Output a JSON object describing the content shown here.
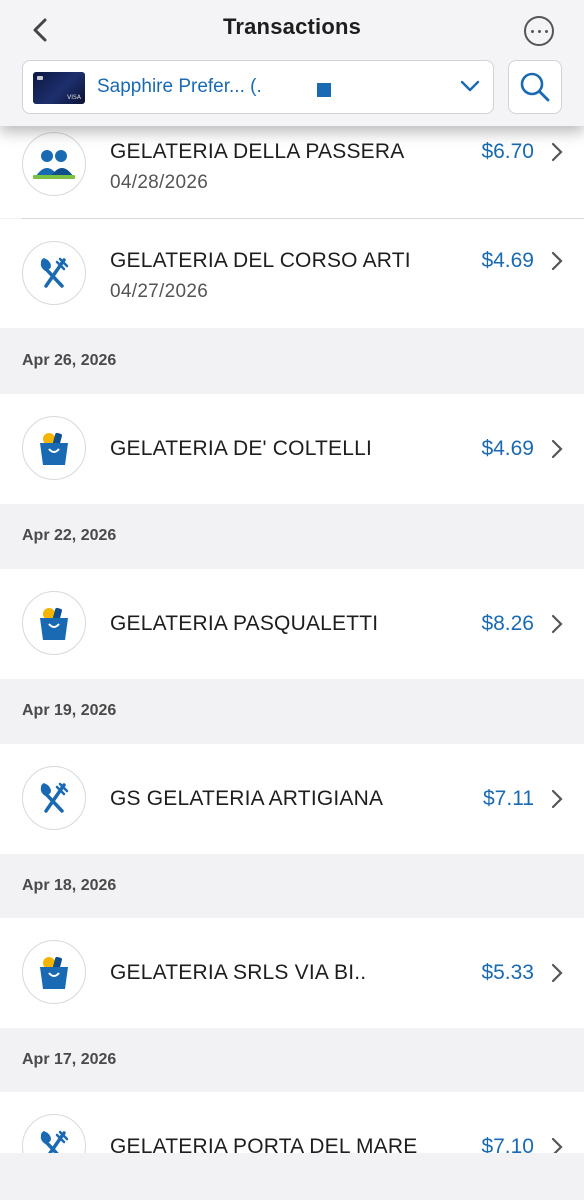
{
  "header": {
    "title": "Transactions",
    "back_icon": "chevron-left-icon",
    "more_icon": "ellipsis-circle-icon"
  },
  "account": {
    "name": "Sapphire Prefer... (.",
    "card_brand": "VISA",
    "search_icon": "search-icon"
  },
  "colors": {
    "accent": "#1a6ab3",
    "section_bg": "#f2f2f5",
    "row_bg": "#ffffff"
  },
  "transactions": [
    {
      "merchant": "GELATERIA DELLA PASSERA",
      "date": "04/28/2026",
      "amount": "$6.70",
      "icon": "people-icon"
    },
    {
      "merchant": "GELATERIA DEL CORSO ARTI",
      "date": "04/27/2026",
      "amount": "$4.69",
      "icon": "fork-spoon-icon"
    }
  ],
  "sections": [
    {
      "date": "Apr 26, 2026",
      "merchant": "GELATERIA DE' COLTELLI",
      "amount": "$4.69",
      "icon": "shopping-bag-icon"
    },
    {
      "date": "Apr 22, 2026",
      "merchant": "GELATERIA PASQUALETTI",
      "amount": "$8.26",
      "icon": "shopping-bag-icon"
    },
    {
      "date": "Apr 19, 2026",
      "merchant": "GS GELATERIA ARTIGIANA",
      "amount": "$7.11",
      "icon": "fork-spoon-icon"
    },
    {
      "date": "Apr 18, 2026",
      "merchant": "GELATERIA SRLS VIA BI..",
      "amount": "$5.33",
      "icon": "shopping-bag-icon"
    },
    {
      "date": "Apr 17, 2026",
      "merchant": "GELATERIA PORTA DEL MARE",
      "amount": "$7.10",
      "icon": "fork-spoon-icon"
    }
  ]
}
